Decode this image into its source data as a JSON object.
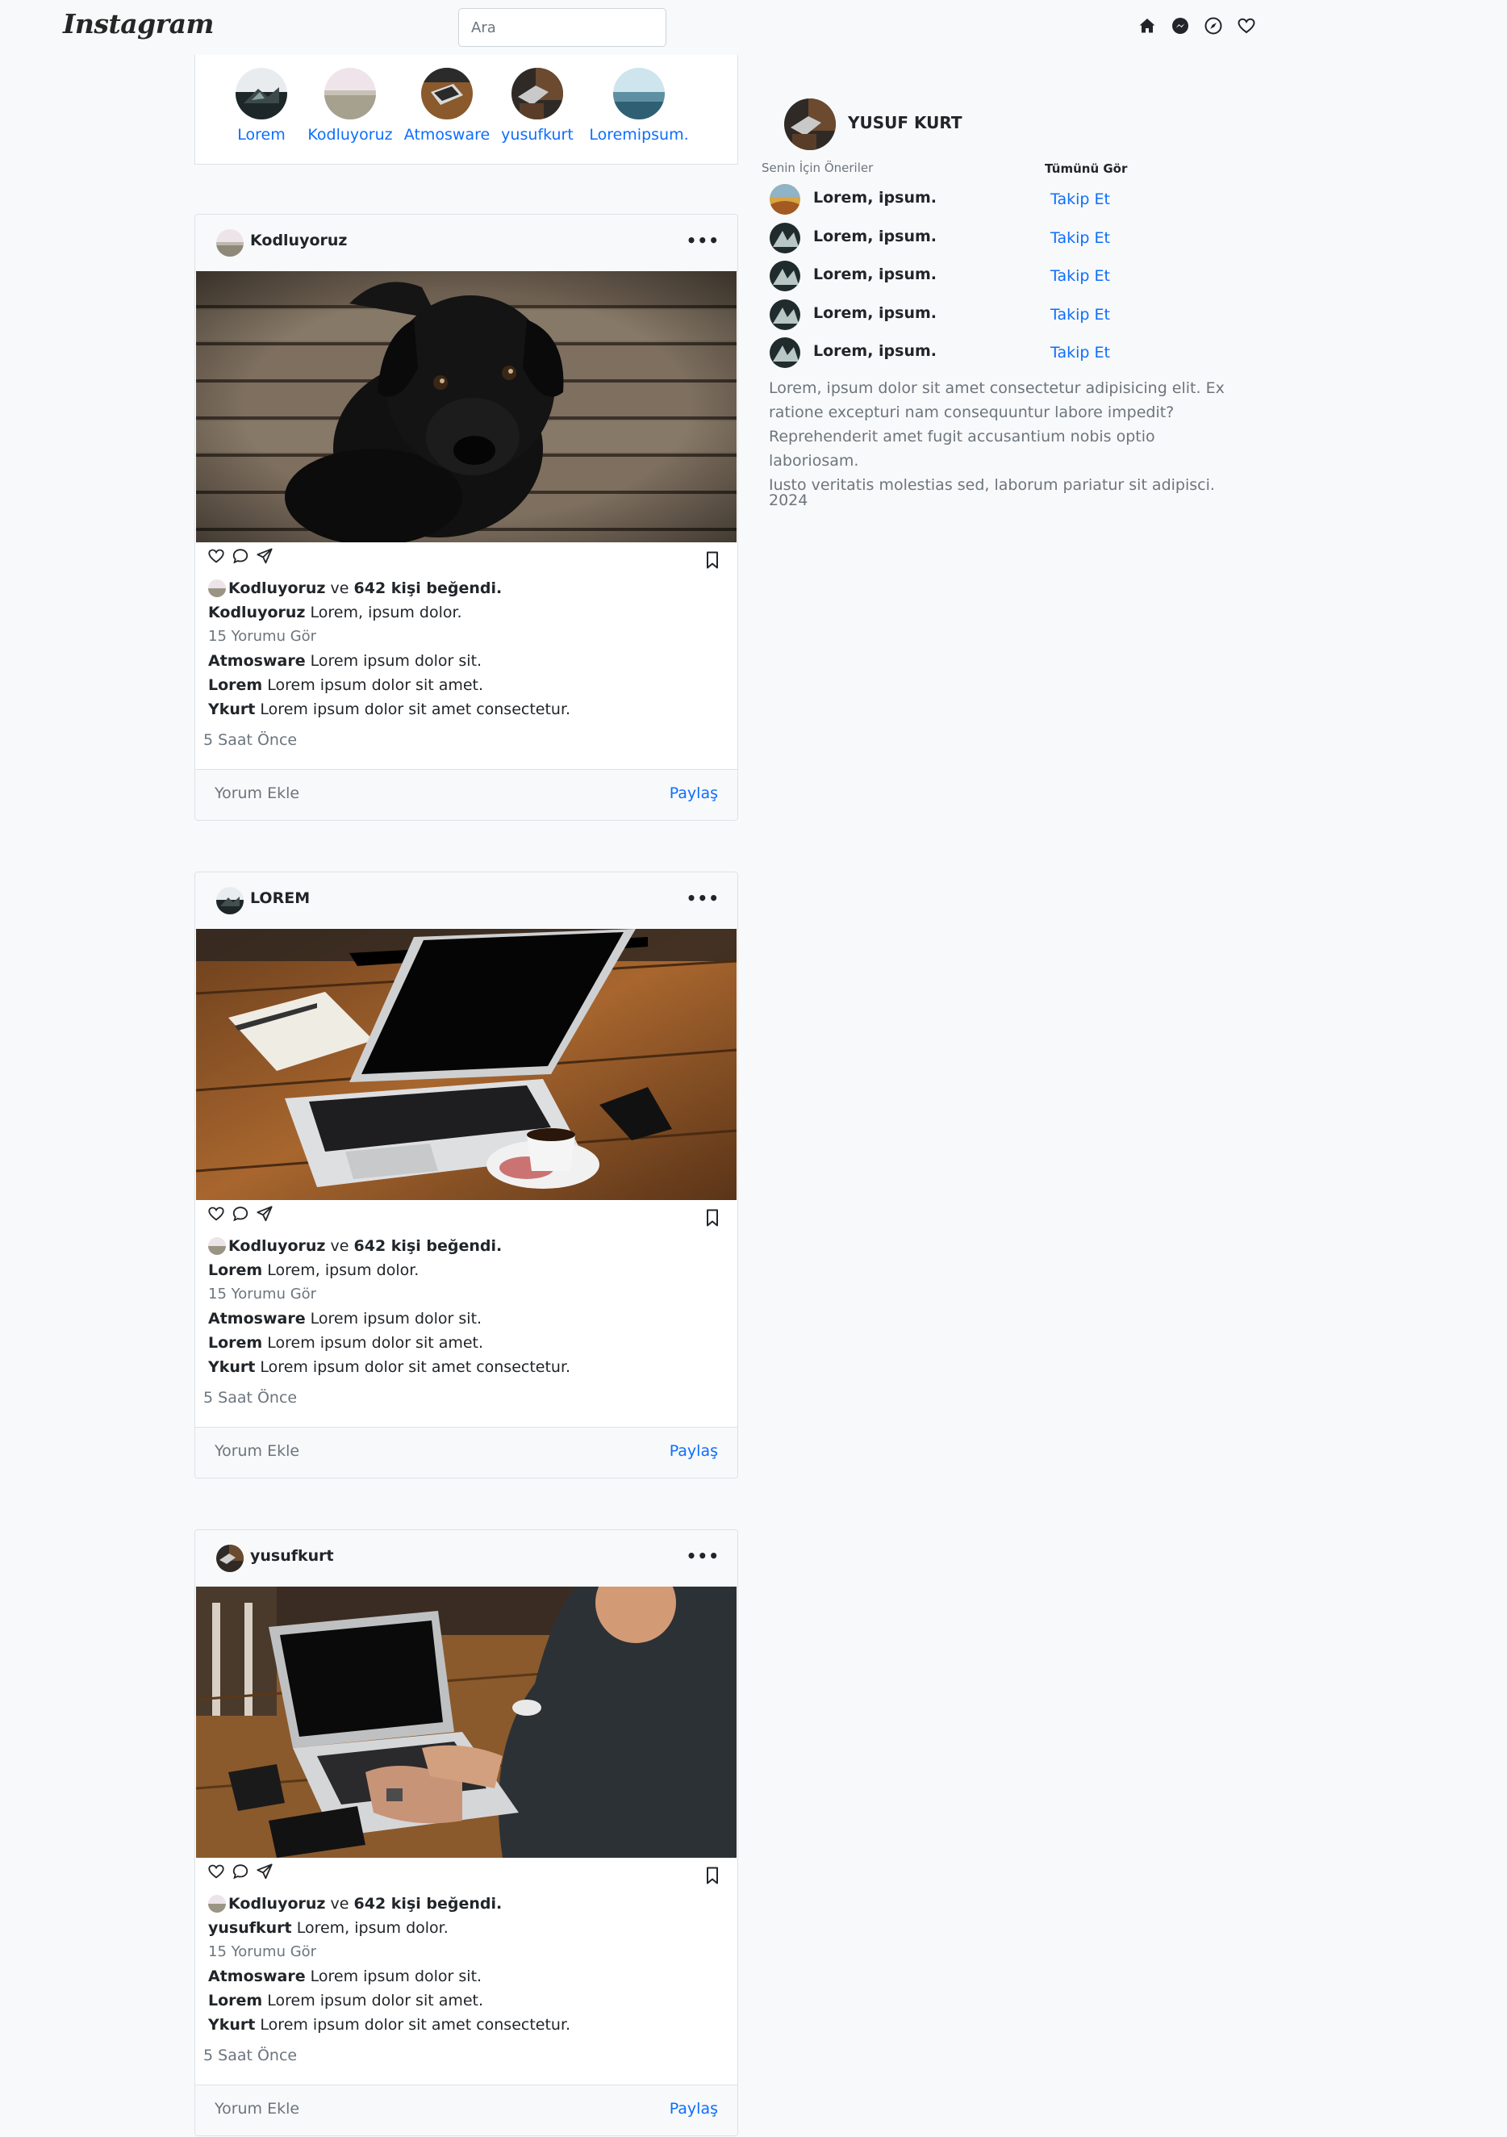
{
  "nav": {
    "brand": "Instagram",
    "search_placeholder": "Ara",
    "icons": [
      "home-icon",
      "messenger-icon",
      "explore-icon",
      "heart-icon"
    ]
  },
  "stories": [
    {
      "name": "Lorem"
    },
    {
      "name": "Kodluyoruz"
    },
    {
      "name": "Atmosware"
    },
    {
      "name": "yusufkurt"
    },
    {
      "name": "Loremipsum."
    }
  ],
  "posts": [
    {
      "user": "Kodluyoruz",
      "image": "black-puppy-on-wooden-floor",
      "likes_user": "Kodluyoruz",
      "likes_and": "ve",
      "likes_count": "642 kişi beğendi.",
      "caption_user": "Kodluyoruz",
      "caption_text": "Lorem, ipsum dolor.",
      "view_comments": "15 Yorumu Gör",
      "comments": [
        {
          "user": "Atmosware",
          "text": "Lorem ipsum dolor sit."
        },
        {
          "user": "Lorem",
          "text": "Lorem ipsum dolor sit amet."
        },
        {
          "user": "Ykurt",
          "text": "Lorem ipsum dolor sit amet consectetur."
        }
      ],
      "time": "5 Saat Önce",
      "add_comment": "Yorum Ekle",
      "share": "Paylaş"
    },
    {
      "user": "LOREM",
      "image": "laptop-notebook-coffee-on-desk",
      "likes_user": "Kodluyoruz",
      "likes_and": "ve",
      "likes_count": "642 kişi beğendi.",
      "caption_user": "Lorem",
      "caption_text": "Lorem, ipsum dolor.",
      "view_comments": "15 Yorumu Gör",
      "comments": [
        {
          "user": "Atmosware",
          "text": "Lorem ipsum dolor sit."
        },
        {
          "user": "Lorem",
          "text": "Lorem ipsum dolor sit amet."
        },
        {
          "user": "Ykurt",
          "text": "Lorem ipsum dolor sit amet consectetur."
        }
      ],
      "time": "5 Saat Önce",
      "add_comment": "Yorum Ekle",
      "share": "Paylaş"
    },
    {
      "user": "yusufkurt",
      "image": "person-typing-on-laptop",
      "likes_user": "Kodluyoruz",
      "likes_and": "ve",
      "likes_count": "642 kişi beğendi.",
      "caption_user": "yusufkurt",
      "caption_text": "Lorem, ipsum dolor.",
      "view_comments": "15 Yorumu Gör",
      "comments": [
        {
          "user": "Atmosware",
          "text": "Lorem ipsum dolor sit."
        },
        {
          "user": "Lorem",
          "text": "Lorem ipsum dolor sit amet."
        },
        {
          "user": "Ykurt",
          "text": "Lorem ipsum dolor sit amet consectetur."
        }
      ],
      "time": "5 Saat Önce",
      "add_comment": "Yorum Ekle",
      "share": "Paylaş"
    }
  ],
  "sidebar": {
    "profile_name": "YUSUF KURT",
    "suggestions_title": "Senin İçin Öneriler",
    "see_all": "Tümünü Gör",
    "suggestions": [
      {
        "name": "Lorem, ipsum.",
        "action": "Takip Et"
      },
      {
        "name": "Lorem, ipsum.",
        "action": "Takip Et"
      },
      {
        "name": "Lorem, ipsum.",
        "action": "Takip Et"
      },
      {
        "name": "Lorem, ipsum.",
        "action": "Takip Et"
      },
      {
        "name": "Lorem, ipsum.",
        "action": "Takip Et"
      }
    ],
    "about_lines": [
      "Lorem, ipsum dolor sit amet consectetur adipisicing elit. Ex",
      "ratione excepturi nam consequuntur labore impedit?",
      "Reprehenderit amet fugit accusantium nobis optio laboriosam.",
      "Iusto veritatis molestias sed, laborum pariatur sit adipisci."
    ],
    "year": "2024"
  },
  "colors": {
    "background": "#f8f9fa",
    "link": "#0d6efd",
    "muted": "#6c757d",
    "border": "#dee2e6"
  }
}
